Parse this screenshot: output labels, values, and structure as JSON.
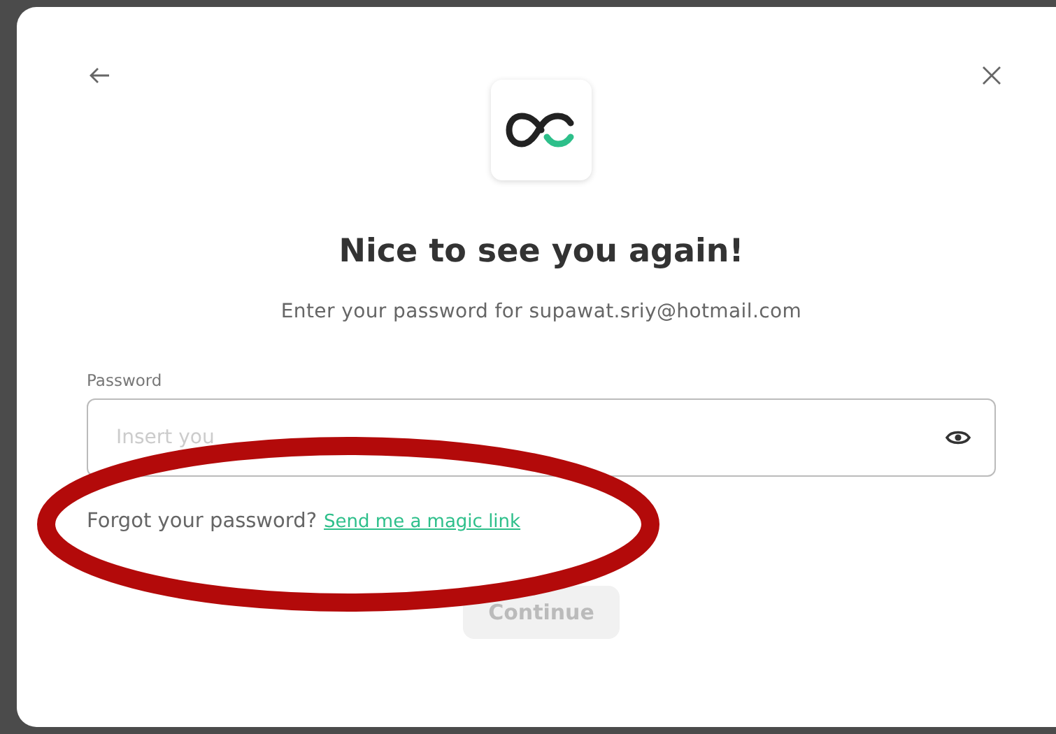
{
  "dialog": {
    "title": "Nice to see you again!",
    "subtitle": "Enter your password for supawat.sriy@hotmail.com",
    "password_field": {
      "label": "Password",
      "placeholder": "Insert you"
    },
    "forgot_text": "Forgot your password?",
    "magic_link": "Send me a magic link",
    "continue_button": {
      "label": "Continue",
      "disabled": true
    }
  }
}
